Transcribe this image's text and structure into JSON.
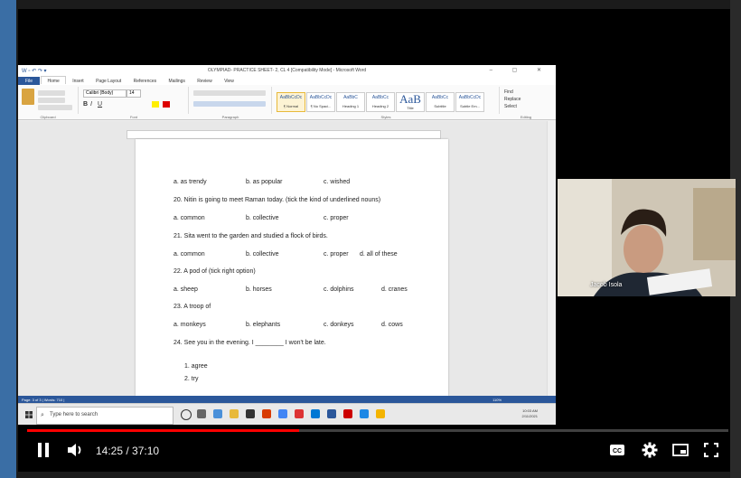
{
  "word": {
    "title": "OLYMPIAD- PRACTICE SHEET- 2, CL 4 [Compatibility Mode] - Microsoft Word",
    "tabs": [
      "File",
      "Home",
      "Insert",
      "Page Layout",
      "References",
      "Mailings",
      "Review",
      "View"
    ],
    "font_name": "Calibri (Body)",
    "font_size": "14",
    "styles": [
      "AaBbCcDc",
      "AaBbCcDc",
      "AaBbC",
      "AaBbCc",
      "AaB",
      "AaBbCc",
      "AaBbCcDc"
    ],
    "style_names": [
      "¶ Normal",
      "¶ No Spaci...",
      "Heading 1",
      "Heading 2",
      "Title",
      "Subtitle",
      "Subtle Em..."
    ],
    "editing": [
      "Find",
      "Replace",
      "Select"
    ],
    "group_labels": [
      "Clipboard",
      "Font",
      "Paragraph",
      "Styles",
      "Editing"
    ],
    "status_left": "Page: 3 of 3  |  Words: 710  |",
    "status_right": "110%"
  },
  "doc": {
    "lines": [
      {
        "cols": [
          "a. as trendy",
          "b. as popular",
          "c. wished"
        ]
      },
      {
        "text": "20. Nitin is going to meet Raman today. (tick the kind of underlined nouns)"
      },
      {
        "cols": [
          "a. common",
          "b. collective",
          "c. proper"
        ]
      },
      {
        "text": "21. Sita went to the garden and studied a flock of birds."
      },
      {
        "cols": [
          "a. common",
          "b. collective",
          "c. proper",
          "d. all of these"
        ]
      },
      {
        "text": "22. A pod of (tick right option)"
      },
      {
        "cols": [
          "a. sheep",
          "b. horses",
          "c. dolphins",
          "d. cranes"
        ]
      },
      {
        "text": "23. A troop of"
      },
      {
        "cols": [
          "a. monkeys",
          "b. elephants",
          "c. donkeys",
          "d. cows"
        ]
      },
      {
        "text": "24. See you in the evening. I ________ I won't be late."
      },
      {
        "text": "1.   agree"
      },
      {
        "text": "2.   try"
      }
    ]
  },
  "taskbar": {
    "search_placeholder": "Type here to search",
    "time": "10:03 AM",
    "date": "2/11/2021"
  },
  "webcam": {
    "name_label": "Jacob Isola"
  },
  "player": {
    "current_time": "14:25",
    "duration": "37:10",
    "time_display": "14:25 / 37:10",
    "progress": 0.388
  },
  "colors": {
    "progress_red": "#ff0000",
    "word_blue": "#2b579a"
  }
}
